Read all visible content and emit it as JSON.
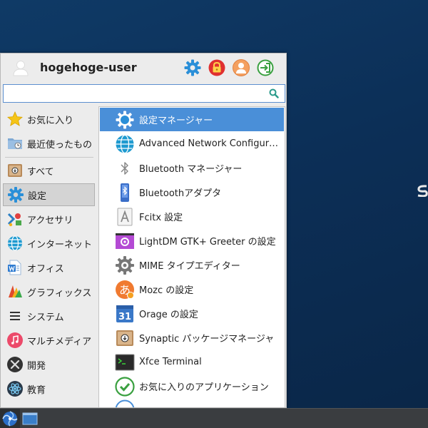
{
  "user": {
    "name": "hogehoge-user"
  },
  "header_buttons": [
    {
      "icon": "settings-icon",
      "color": "#2a8fd8"
    },
    {
      "icon": "lock-icon",
      "color": "#e03030"
    },
    {
      "icon": "switch-user-icon",
      "color": "#f08a40"
    },
    {
      "icon": "logout-icon",
      "color": "#3aa040"
    }
  ],
  "search": {
    "value": "",
    "placeholder": ""
  },
  "categories": [
    {
      "label": "お気に入り",
      "icon": "star-icon"
    },
    {
      "label": "最近使ったもの",
      "icon": "recent-folder-icon"
    },
    {
      "label": "すべて",
      "icon": "all-apps-icon"
    },
    {
      "label": "設定",
      "icon": "settings-gear-icon",
      "selected": true
    },
    {
      "label": "アクセサリ",
      "icon": "accessories-icon"
    },
    {
      "label": "インターネット",
      "icon": "internet-globe-icon"
    },
    {
      "label": "オフィス",
      "icon": "office-icon"
    },
    {
      "label": "グラフィックス",
      "icon": "graphics-icon"
    },
    {
      "label": "システム",
      "icon": "system-icon"
    },
    {
      "label": "マルチメディア",
      "icon": "multimedia-icon"
    },
    {
      "label": "開発",
      "icon": "development-icon"
    },
    {
      "label": "教育",
      "icon": "education-icon"
    }
  ],
  "apps": [
    {
      "label": "設定マネージャー",
      "icon": "settings-manager-icon",
      "selected": true
    },
    {
      "label": "Advanced Network Configur…",
      "icon": "network-config-icon"
    },
    {
      "label": "Bluetooth マネージャー",
      "icon": "bluetooth-manager-icon"
    },
    {
      "label": "Bluetoothアダプタ",
      "icon": "bluetooth-adapter-icon"
    },
    {
      "label": "Fcitx 設定",
      "icon": "fcitx-icon"
    },
    {
      "label": "LightDM GTK+ Greeter の設定",
      "icon": "lightdm-icon"
    },
    {
      "label": "MIME タイプエディター",
      "icon": "mime-editor-icon"
    },
    {
      "label": "Mozc の設定",
      "icon": "mozc-icon"
    },
    {
      "label": "Orage の設定",
      "icon": "orage-calendar-icon"
    },
    {
      "label": "Synaptic パッケージマネージャ",
      "icon": "synaptic-icon"
    },
    {
      "label": "Xfce Terminal",
      "icon": "terminal-icon"
    },
    {
      "label": "お気に入りのアプリケーション",
      "icon": "favorite-apps-icon"
    }
  ],
  "colors": {
    "accent": "#4a8fd8",
    "desktop": "#0c2f57",
    "taskbar": "#3a3d40"
  },
  "calendar_day": "31"
}
